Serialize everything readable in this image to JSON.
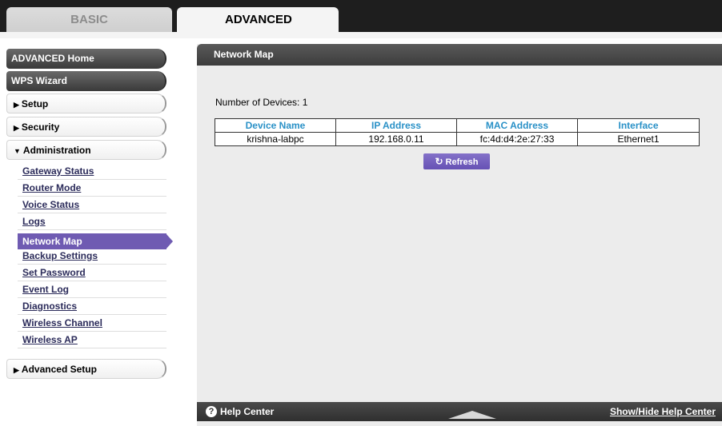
{
  "tabs": {
    "basic": "BASIC",
    "advanced": "ADVANCED"
  },
  "menu": {
    "advanced_home": "ADVANCED Home",
    "wps_wizard": "WPS Wizard",
    "setup": "Setup",
    "security": "Security",
    "administration": "Administration",
    "admin_items": [
      "Gateway Status",
      "Router Mode",
      "Voice Status",
      "Logs",
      "Network Map",
      "Backup Settings",
      "Set Password",
      "Event Log",
      "Diagnostics",
      "Wireless Channel",
      "Wireless AP"
    ],
    "advanced_setup": "Advanced Setup"
  },
  "panel": {
    "title": "Network Map",
    "device_count": "Number of Devices: 1",
    "columns": [
      "Device Name",
      "IP Address",
      "MAC Address",
      "Interface"
    ],
    "rows": [
      [
        "krishna-labpc",
        "192.168.0.11",
        "fc:4d:d4:2e:27:33",
        "Ethernet1"
      ]
    ],
    "refresh": "Refresh"
  },
  "help": {
    "label": "Help Center",
    "toggle": "Show/Hide Help Center"
  },
  "colors": {
    "accent": "#6f5bb2",
    "header_text": "#2a91c7"
  },
  "icons": {
    "refresh": "refresh-icon",
    "help": "help-icon",
    "arrow": "triangle-right-icon"
  }
}
